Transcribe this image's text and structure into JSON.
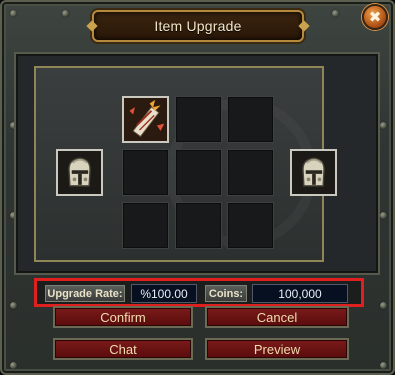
{
  "window": {
    "title": "Item Upgrade"
  },
  "close": {
    "glyph": "✖",
    "icon": "close-icon"
  },
  "slots": {
    "material": {
      "icon": "upgrade-scroll-icon",
      "accent": "#e2533a"
    },
    "source_item": {
      "icon": "knight-helmet-icon"
    },
    "result_item": {
      "icon": "knight-helmet-icon"
    }
  },
  "info": {
    "upgrade_rate_label": "Upgrade Rate:",
    "upgrade_rate_value": "%100.00",
    "coins_label": "Coins:",
    "coins_value": "100,000",
    "highlight_color": "#e01f1f"
  },
  "buttons": {
    "confirm": "Confirm",
    "cancel": "Cancel",
    "chat": "Chat",
    "preview": "Preview"
  }
}
